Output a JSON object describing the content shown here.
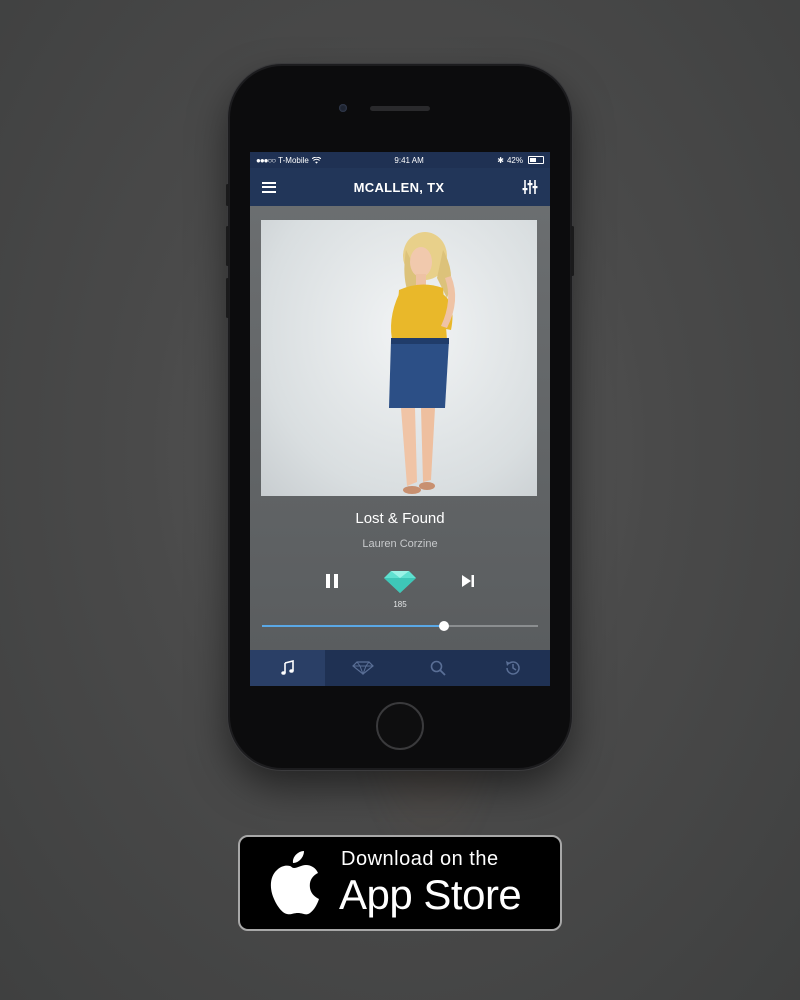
{
  "status_bar": {
    "carrier": "T-Mobile",
    "time": "9:41 AM",
    "battery": "42%"
  },
  "nav": {
    "title": "MCALLEN, TX"
  },
  "player": {
    "track_title": "Lost & Found",
    "artist": "Lauren Corzine",
    "gem_count": "185",
    "progress_fraction": 0.66
  },
  "tabs": [
    {
      "icon": "music-note-icon",
      "active": true
    },
    {
      "icon": "diamond-icon",
      "active": false
    },
    {
      "icon": "search-icon",
      "active": false
    },
    {
      "icon": "history-icon",
      "active": false
    }
  ],
  "app_store_badge": {
    "line1": "Download on the",
    "line2": "App Store"
  },
  "colors": {
    "nav_bar": "#223659",
    "accent_blue": "#5aa8e6",
    "gem": "#5fe0d0"
  }
}
